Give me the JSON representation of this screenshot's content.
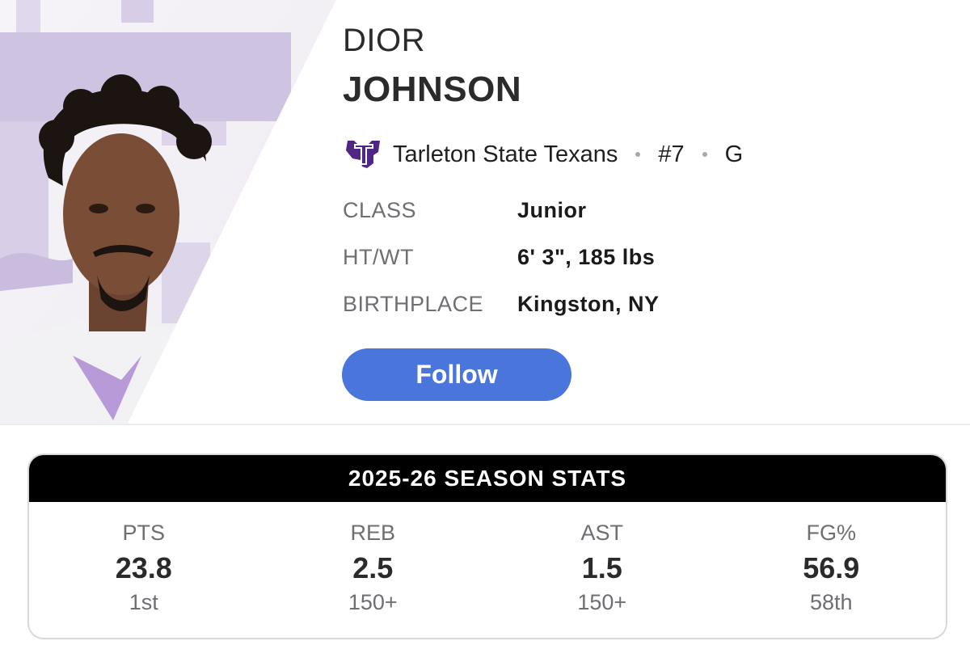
{
  "player": {
    "first_name": "DIOR",
    "last_name": "JOHNSON",
    "team": "Tarleton State Texans",
    "number": "#7",
    "position": "G",
    "team_logo_letter": "T"
  },
  "bio": [
    {
      "label": "CLASS",
      "value": "Junior"
    },
    {
      "label": "HT/WT",
      "value": "6' 3\", 185 lbs"
    },
    {
      "label": "BIRTHPLACE",
      "value": "Kingston, NY"
    }
  ],
  "follow_label": "Follow",
  "stats": {
    "title": "2025-26 SEASON STATS",
    "items": [
      {
        "label": "PTS",
        "value": "23.8",
        "rank": "1st"
      },
      {
        "label": "REB",
        "value": "2.5",
        "rank": "150+"
      },
      {
        "label": "AST",
        "value": "1.5",
        "rank": "150+"
      },
      {
        "label": "FG%",
        "value": "56.9",
        "rank": "58th"
      }
    ]
  },
  "colors": {
    "accent_blue": "#4a76dc",
    "team_purple": "#4f2683",
    "header_black": "#000000"
  }
}
